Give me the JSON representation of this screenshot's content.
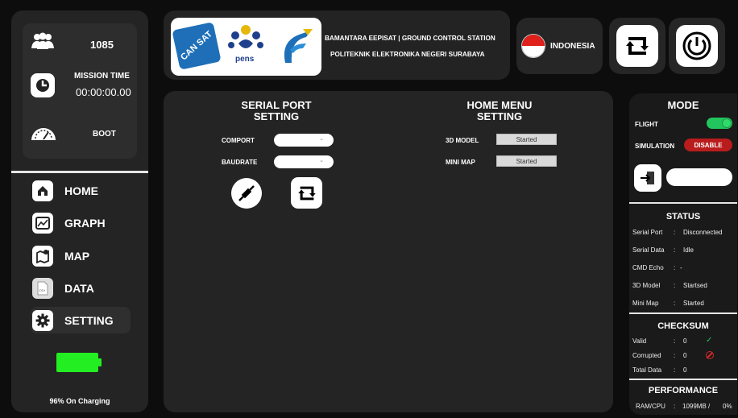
{
  "sidebar": {
    "participant_count": "1085",
    "mission_time_label": "MISSION TIME",
    "mission_time_value": "00:00:00.00",
    "state_label": "BOOT",
    "nav": [
      {
        "label": "HOME"
      },
      {
        "label": "GRAPH"
      },
      {
        "label": "MAP"
      },
      {
        "label": "DATA"
      },
      {
        "label": "SETTING"
      }
    ],
    "battery_percent": 96,
    "battery_status": "96% On Charging"
  },
  "header": {
    "logo_cansat_text": "CAN SAT",
    "logo_pens_text": "pens",
    "title_line1": "BAMANTARA EEPISAT | GROUND CONTROL STATION",
    "title_line2": "POLITEKNIK ELEKTRONIKA NEGERI SURABAYA",
    "language": "INDONESIA"
  },
  "serial_port": {
    "title": "SERIAL PORT SETTING",
    "comport_label": "COMPORT",
    "baudrate_label": "BAUDRATE",
    "comport_value": "",
    "baudrate_value": ""
  },
  "home_menu": {
    "title": "HOME MENU SETTING",
    "model_label": "3D MODEL",
    "model_status": "Started",
    "map_label": "MINI MAP",
    "map_status": "Started"
  },
  "mode": {
    "title": "MODE",
    "flight_label": "FLIGHT",
    "flight_on": true,
    "simulation_label": "SIMULATION",
    "simulation_button": "DISABLE"
  },
  "status": {
    "title": "STATUS",
    "rows": [
      {
        "label": "Serial Port",
        "value": "Disconnected"
      },
      {
        "label": "Serial Data",
        "value": "Idle"
      },
      {
        "label": "CMD Echo",
        "value": "-"
      },
      {
        "label": "3D Model",
        "value": "Startsed"
      },
      {
        "label": "Mini Map",
        "value": "Started"
      }
    ]
  },
  "checksum": {
    "title": "CHECKSUM",
    "rows": [
      {
        "label": "Valid",
        "value": "0"
      },
      {
        "label": "Corrupted",
        "value": "0"
      },
      {
        "label": "Total Data",
        "value": "0"
      }
    ]
  },
  "performance": {
    "title": "PERFORMANCE",
    "label": "RAM/CPU",
    "value": "1099MB /",
    "cpu": "0%"
  },
  "colors": {
    "panel": "#242424",
    "accent_green": "#22c55e",
    "danger": "#b91c1c",
    "battery": "#22ee22"
  }
}
